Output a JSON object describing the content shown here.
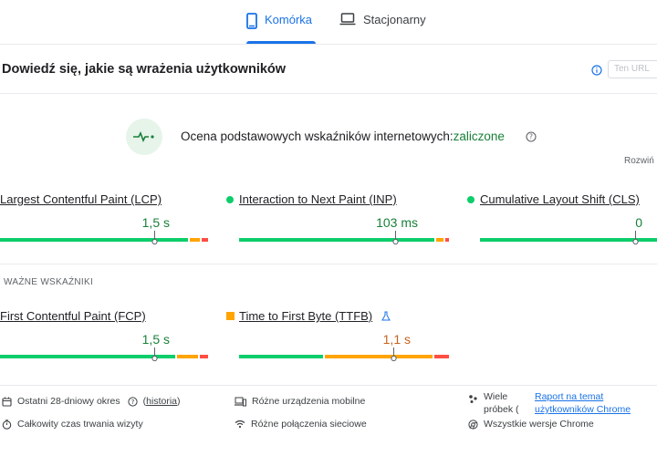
{
  "tabs": [
    {
      "label": "Komórka",
      "active": true,
      "icon": "phone-icon"
    },
    {
      "label": "Stacjonarny",
      "active": false,
      "icon": "laptop-icon"
    }
  ],
  "header": {
    "title": "Dowiedź się, jakie są wrażenia użytkowników",
    "url_placeholder": "Ten URL"
  },
  "assessment": {
    "label": "Ocena podstawowych wskaźników internetowych:",
    "result": "zaliczone",
    "expand": "Rozwiń"
  },
  "metrics_core": [
    {
      "name": "Largest Contentful Paint (LCP)",
      "value": "1,5 s",
      "status": "good",
      "position": 0.76
    },
    {
      "name": "Interaction to Next Paint (INP)",
      "value": "103 ms",
      "status": "good",
      "position": 0.8
    },
    {
      "name": "Cumulative Layout Shift (CLS)",
      "value": "0",
      "status": "good",
      "position": 0.97
    }
  ],
  "other_label": "WAŻNE WSKAŹNIKI",
  "metrics_other": [
    {
      "name": "First Contentful Paint (FCP)",
      "value": "1,5 s",
      "status": "good",
      "position": 0.76
    },
    {
      "name": "Time to First Byte (TTFB)",
      "value": "1,1 s",
      "status": "needs-improvement",
      "position": 0.74
    }
  ],
  "footer": {
    "period": "Ostatni 28-dniowy okres",
    "history": "historia",
    "devices": "Różne urządzenia mobilne",
    "samples": "Wiele próbek (",
    "report": "Raport na temat użytkowników Chrome",
    "duration": "Całkowity czas trwania wizyty",
    "connections": "Różne połączenia sieciowe",
    "versions": "Wszystkie wersje Chrome"
  },
  "colors": {
    "accent": "#1a73e8",
    "good": "#0cce6b",
    "average": "#ffa400",
    "poor": "#ff4e42"
  }
}
